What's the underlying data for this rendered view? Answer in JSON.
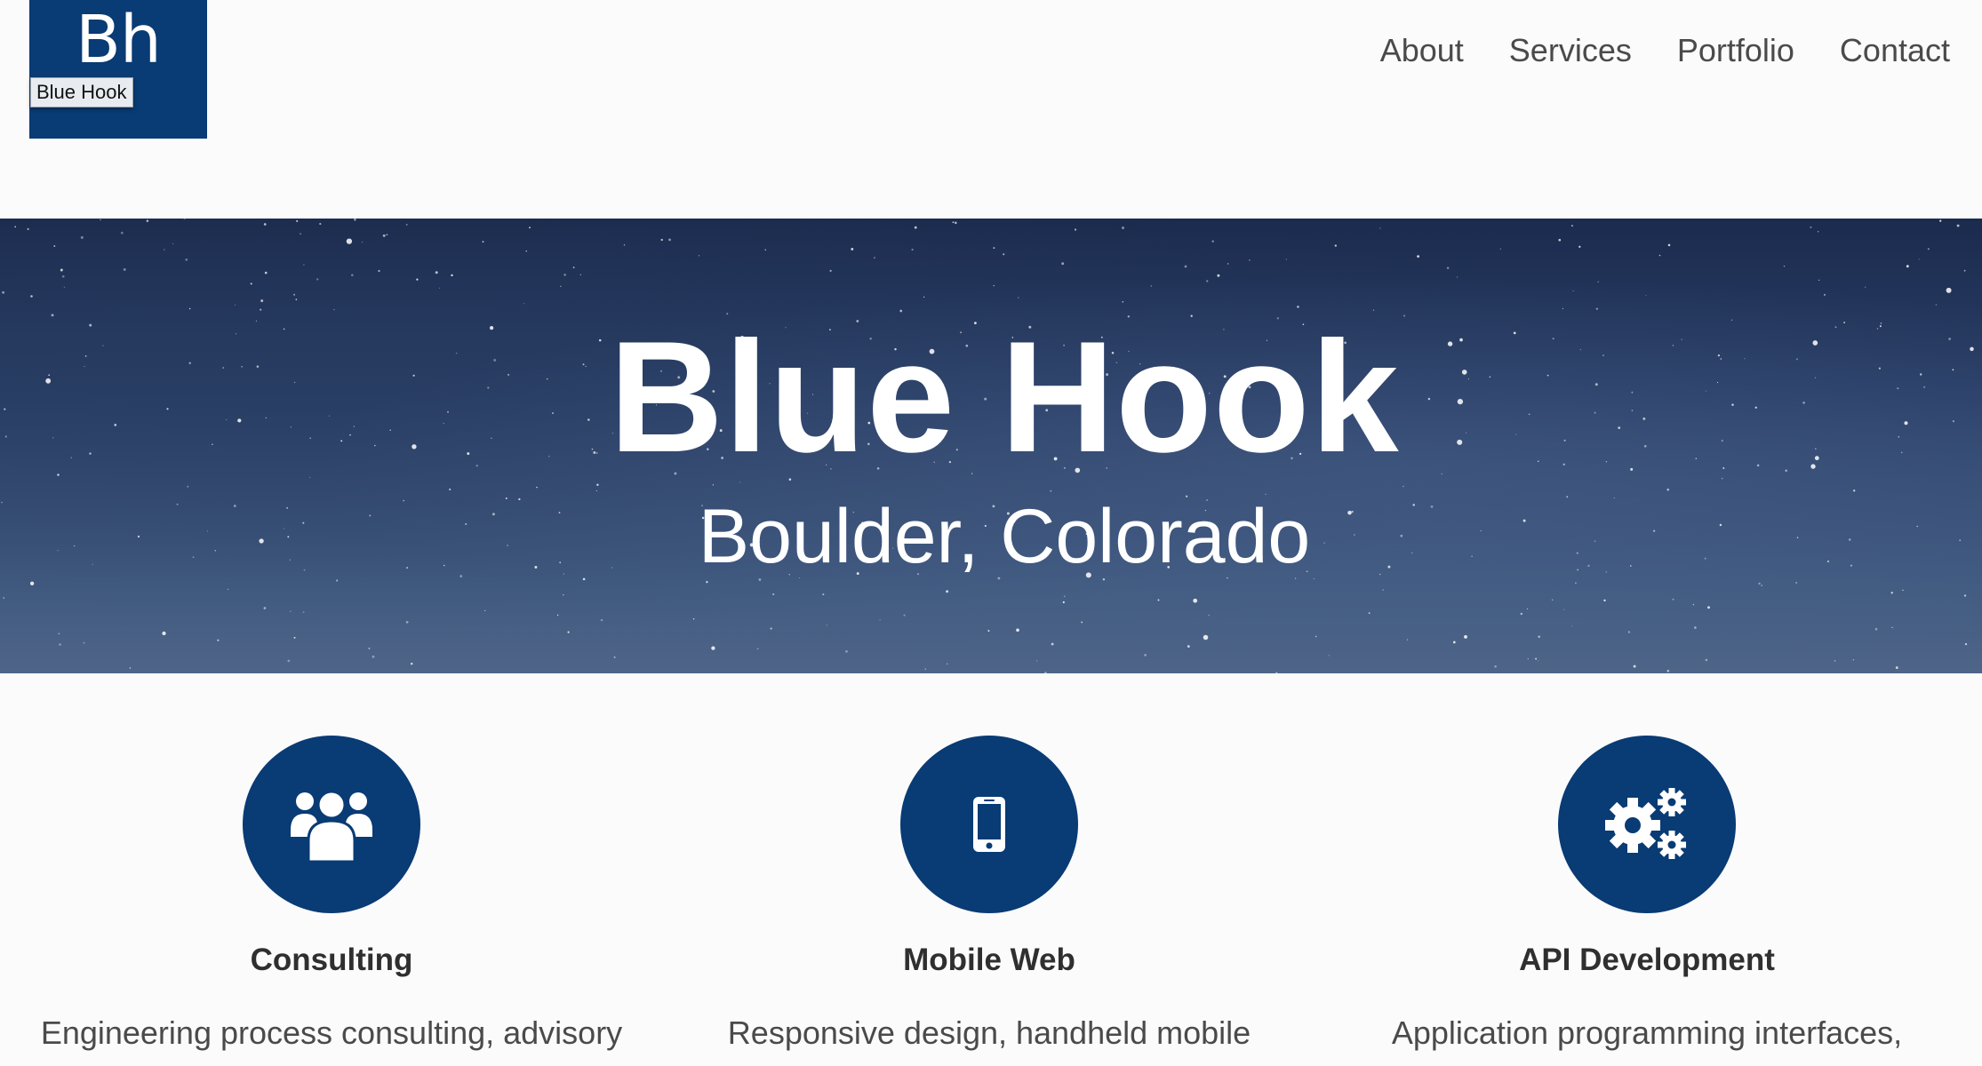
{
  "header": {
    "logo_mark": "Bh",
    "logo_tooltip": "Blue Hook",
    "nav": [
      {
        "label": "About"
      },
      {
        "label": "Services"
      },
      {
        "label": "Portfolio"
      },
      {
        "label": "Contact"
      }
    ]
  },
  "hero": {
    "title": "Blue Hook",
    "subtitle": "Boulder, Colorado"
  },
  "services": [
    {
      "icon": "users-icon",
      "title": "Consulting",
      "description": "Engineering process consulting, advisory"
    },
    {
      "icon": "mobile-phone-icon",
      "title": "Mobile Web",
      "description": "Responsive design, handheld mobile"
    },
    {
      "icon": "gears-icon",
      "title": "API Development",
      "description": "Application programming interfaces,"
    }
  ],
  "colors": {
    "brand": "#093b74",
    "nav_text": "#4a4a4a",
    "heading_text": "#2f2f2f",
    "page_bg": "#fbfbfc"
  }
}
